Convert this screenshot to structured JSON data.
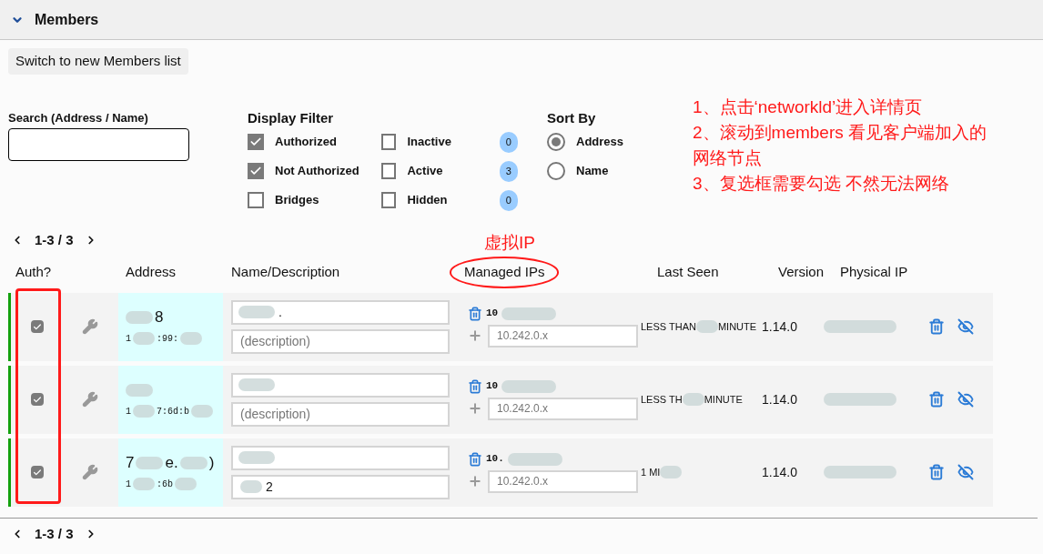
{
  "section": {
    "title": "Members",
    "expanded": true
  },
  "switch_button": "Switch to new Members list",
  "search": {
    "label": "Search (Address / Name)"
  },
  "display_filter": {
    "title": "Display Filter",
    "items": [
      {
        "label": "Authorized",
        "checked": true
      },
      {
        "label": "Inactive",
        "checked": false,
        "count": "0"
      },
      {
        "label": "Not Authorized",
        "checked": true
      },
      {
        "label": "Active",
        "checked": false,
        "count": "3"
      },
      {
        "label": "Bridges",
        "checked": false
      },
      {
        "label": "Hidden",
        "checked": false,
        "count": "0"
      }
    ]
  },
  "sort_by": {
    "title": "Sort By",
    "options": [
      {
        "label": "Address",
        "selected": true
      },
      {
        "label": "Name",
        "selected": false
      }
    ]
  },
  "pagination_top": "1-3 / 3",
  "pagination_bottom": "1-3 / 3",
  "table": {
    "columns": [
      "Auth?",
      "Address",
      "Name/Description",
      "Managed IPs",
      "Last Seen",
      "Version",
      "Physical IP"
    ],
    "rows": [
      {
        "authorized": true,
        "address_main": [
          {
            "kind": "blur"
          },
          {
            "kind": "text",
            "text": "8"
          }
        ],
        "address_sub": [
          {
            "kind": "text",
            "text": "1"
          },
          {
            "kind": "blur"
          },
          {
            "kind": "text",
            "text": ":99:"
          },
          {
            "kind": "blur"
          }
        ],
        "name": [
          {
            "kind": "blur"
          },
          {
            "kind": "text",
            "text": "."
          }
        ],
        "description": [],
        "description_placeholder": "(description)",
        "ip": "10",
        "ip_placeholder": "10.242.0.x",
        "last_seen": [
          {
            "kind": "text",
            "text": "LESS THAN"
          },
          {
            "kind": "blur"
          },
          {
            "kind": "text",
            "text": "MINUTE"
          }
        ],
        "version": "1.14.0"
      },
      {
        "authorized": true,
        "address_main": [
          {
            "kind": "blur"
          }
        ],
        "address_sub": [
          {
            "kind": "text",
            "text": "1"
          },
          {
            "kind": "blur"
          },
          {
            "kind": "text",
            "text": "7:6d:b"
          },
          {
            "kind": "blur"
          }
        ],
        "name": [
          {
            "kind": "blur"
          }
        ],
        "description": [],
        "description_placeholder": "(description)",
        "ip": "10",
        "ip_placeholder": "10.242.0.x",
        "last_seen": [
          {
            "kind": "text",
            "text": "LESS TH"
          },
          {
            "kind": "blur"
          },
          {
            "kind": "text",
            "text": "MINUTE"
          }
        ],
        "version": "1.14.0"
      },
      {
        "authorized": true,
        "address_main": [
          {
            "kind": "text",
            "text": "7"
          },
          {
            "kind": "blur"
          },
          {
            "kind": "text",
            "text": "e."
          },
          {
            "kind": "blur"
          },
          {
            "kind": "text",
            "text": ")"
          }
        ],
        "address_sub": [
          {
            "kind": "text",
            "text": "1"
          },
          {
            "kind": "blur"
          },
          {
            "kind": "text",
            "text": ":6b"
          },
          {
            "kind": "blur"
          }
        ],
        "name": [
          {
            "kind": "blur"
          }
        ],
        "description": [
          {
            "kind": "blur"
          },
          {
            "kind": "text",
            "text": "2"
          }
        ],
        "ip": "10.",
        "ip_placeholder": "10.242.0.x",
        "last_seen": [
          {
            "kind": "text",
            "text": "1 MI"
          },
          {
            "kind": "blur"
          }
        ],
        "version": "1.14.0"
      }
    ]
  },
  "annotations": {
    "notes": [
      "1、点击‘networkld’进入详情页",
      "2、滚动到members 看见客户端加入的网络节点",
      "3、复选框需要勾选 不然无法网络"
    ],
    "ip_label": "虚拟IP"
  }
}
